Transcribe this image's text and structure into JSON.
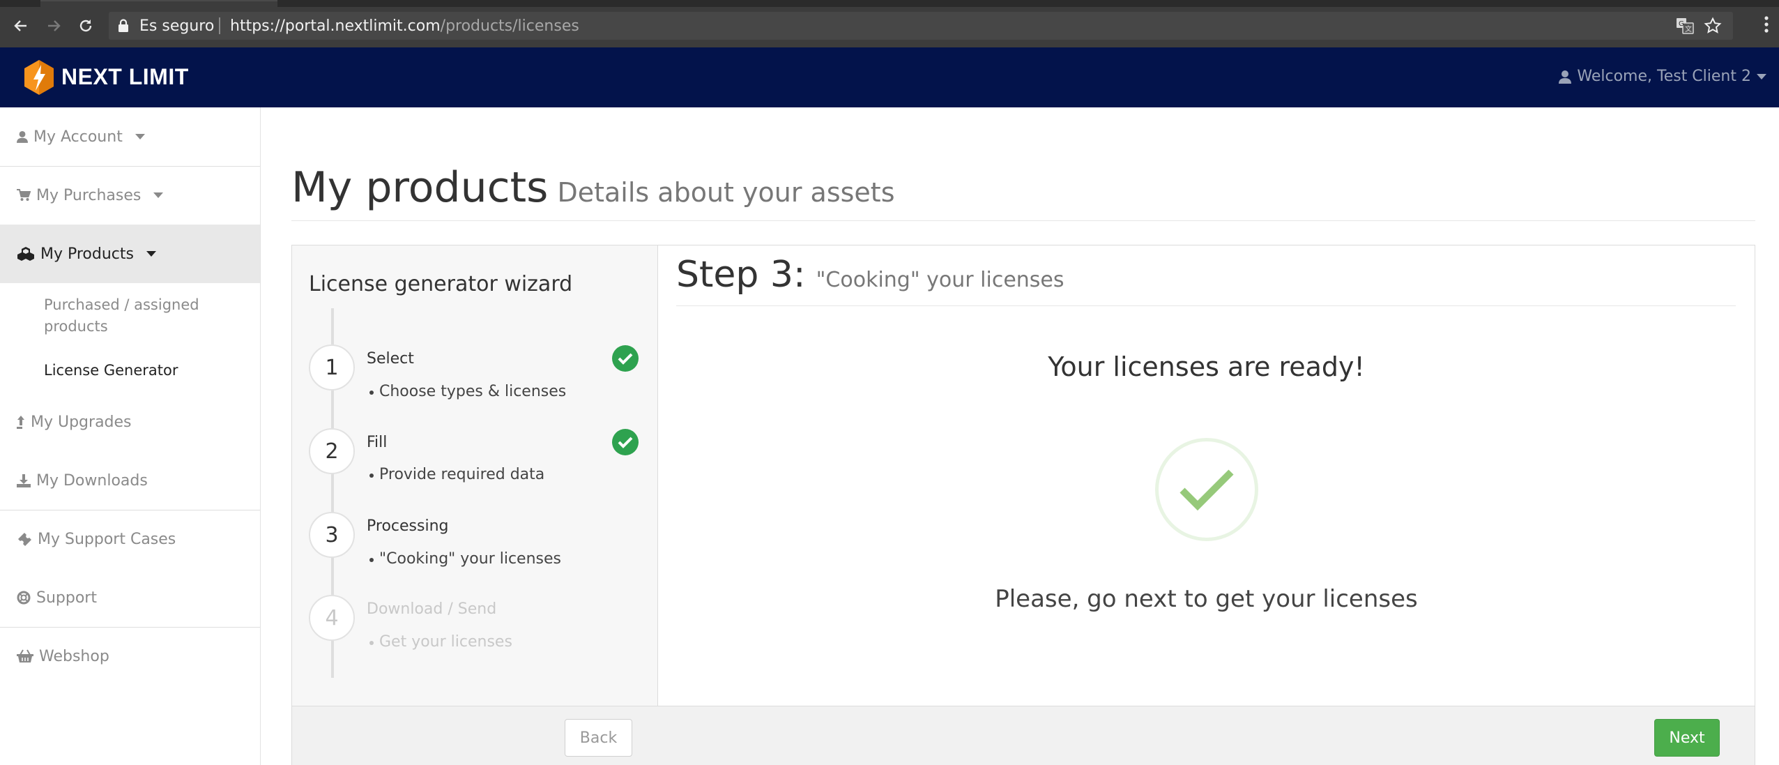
{
  "browser": {
    "secure_label": "Es seguro",
    "url_domain": "https://portal.nextlimit.com",
    "url_path": "/products/licenses"
  },
  "topbar": {
    "brand": "NEXT LIMIT",
    "welcome": "Welcome, Test Client 2",
    "accent_color": "#f7941d",
    "background_color": "#03134b"
  },
  "sidebar": {
    "items": [
      {
        "label": "My Account",
        "icon": "user-icon"
      },
      {
        "label": "My Purchases",
        "icon": "cart-icon"
      },
      {
        "label": "My Products",
        "icon": "cubes-icon"
      },
      {
        "label": "My Upgrades",
        "icon": "upload-icon"
      },
      {
        "label": "My Downloads",
        "icon": "download-icon"
      },
      {
        "label": "My Support Cases",
        "icon": "ticket-icon"
      },
      {
        "label": "Support",
        "icon": "lifebuoy-icon"
      },
      {
        "label": "Webshop",
        "icon": "basket-icon"
      }
    ],
    "sub_items": [
      {
        "label": "Purchased / assigned products"
      },
      {
        "label": "License Generator"
      }
    ]
  },
  "page": {
    "title": "My products",
    "subtitle": "Details about your assets"
  },
  "wizard": {
    "title": "License generator wizard",
    "steps": [
      {
        "number": "1",
        "name": "Select",
        "detail": "Choose types & licenses",
        "completed": true
      },
      {
        "number": "2",
        "name": "Fill",
        "detail": "Provide required data",
        "completed": true
      },
      {
        "number": "3",
        "name": "Processing",
        "detail": "\"Cooking\" your licenses",
        "completed": false
      },
      {
        "number": "4",
        "name": "Download / Send",
        "detail": "Get your licenses",
        "completed": false
      }
    ],
    "content": {
      "step_label": "Step 3:",
      "step_desc": "\"Cooking\" your licenses",
      "ready_text": "Your licenses are ready!",
      "instruction": "Please, go next to get your licenses"
    },
    "back_label": "Back",
    "next_label": "Next",
    "success_color": "#2ea24f"
  }
}
